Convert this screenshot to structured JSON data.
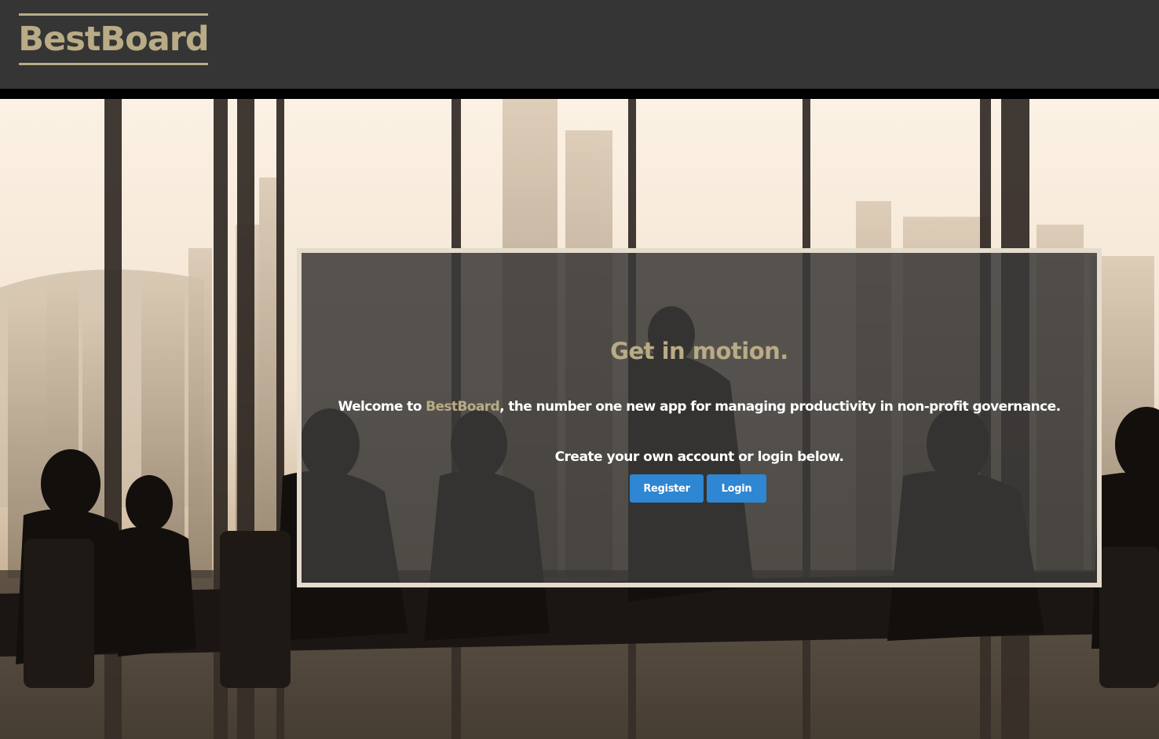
{
  "header": {
    "logo_text": "BestBoard"
  },
  "hero": {
    "image_name": "boardroom-silhouette-photo"
  },
  "panel": {
    "title": "Get in motion.",
    "welcome_prefix": "Welcome to ",
    "welcome_brand": "BestBoard",
    "welcome_suffix": ", the number one new app for managing productivity in non-profit governance.",
    "create_text": "Create your own account or login below.",
    "register_label": "Register",
    "login_label": "Login"
  },
  "colors": {
    "header_bg": "#353535",
    "brand_gold": "#b9ab85",
    "button_blue": "#2f86d2",
    "panel_border": "#e6dccd"
  }
}
